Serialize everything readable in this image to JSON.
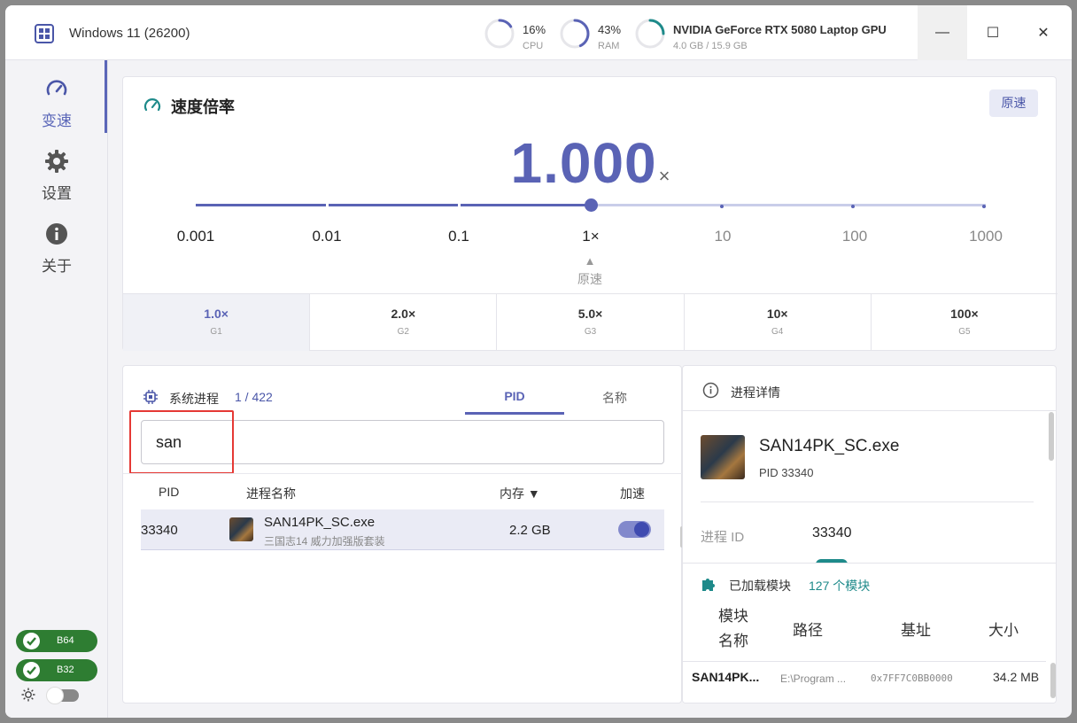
{
  "titlebar": {
    "app_title": "Windows 11 (26200)",
    "cpu": {
      "value": "16%",
      "label": "CPU",
      "fraction": 0.16
    },
    "ram": {
      "value": "43%",
      "label": "RAM",
      "fraction": 0.43
    },
    "gpu": {
      "name": "NVIDIA GeForce RTX 5080 Laptop GPU",
      "memory": "4.0 GB / 15.9 GB",
      "fraction": 0.25
    },
    "minimize": "—",
    "maximize": "☐",
    "close": "✕"
  },
  "sidebar": {
    "items": [
      {
        "label": "变速",
        "icon": "speedometer-icon"
      },
      {
        "label": "设置",
        "icon": "gear-icon"
      },
      {
        "label": "关于",
        "icon": "info-icon"
      }
    ],
    "badges": [
      "B64",
      "B32"
    ],
    "theme_icon": "sun-icon"
  },
  "speed": {
    "title": "速度倍率",
    "reset_button": "原速",
    "value": "1.000",
    "unit": "×",
    "slider_labels": [
      "0.001",
      "0.01",
      "0.1",
      "1×",
      "10",
      "100",
      "1000"
    ],
    "slider_position": 0.5,
    "origin_marker": "▲",
    "origin_label": "原速",
    "presets": [
      {
        "value": "1.0×",
        "key": "G1"
      },
      {
        "value": "2.0×",
        "key": "G2"
      },
      {
        "value": "5.0×",
        "key": "G3"
      },
      {
        "value": "10×",
        "key": "G4"
      },
      {
        "value": "100×",
        "key": "G5"
      }
    ]
  },
  "processes": {
    "title": "系统进程",
    "count": "1 / 422",
    "tabs": [
      "PID",
      "名称"
    ],
    "search_value": "san",
    "columns": {
      "pid": "PID",
      "name": "进程名称",
      "memory": "内存 ▼",
      "accel": "加速"
    },
    "rows": [
      {
        "pid": "33340",
        "name": "SAN14PK_SC.exe",
        "desc": "三国志14 威力加强版套装",
        "memory": "2.2 GB",
        "accelerated": true
      }
    ]
  },
  "details": {
    "title": "进程详情",
    "name": "SAN14PK_SC.exe",
    "pid_line": "PID 33340",
    "pid_key": "进程 ID",
    "pid_value": "33340",
    "modules_title": "已加载模块",
    "modules_count": "127 个模块",
    "module_columns": {
      "name_l1": "模块",
      "name_l2": "名称",
      "path": "路径",
      "base": "基址",
      "size": "大小"
    },
    "module_rows": [
      {
        "name": "SAN14PK...",
        "path": "E:\\Program ...",
        "base": "0x7FF7C0BB0000",
        "size": "34.2 MB"
      }
    ]
  },
  "colors": {
    "accent": "#5a63b5",
    "teal": "#1e8a8a",
    "badge_green": "#2e7d32",
    "highlight": "#e53935"
  }
}
